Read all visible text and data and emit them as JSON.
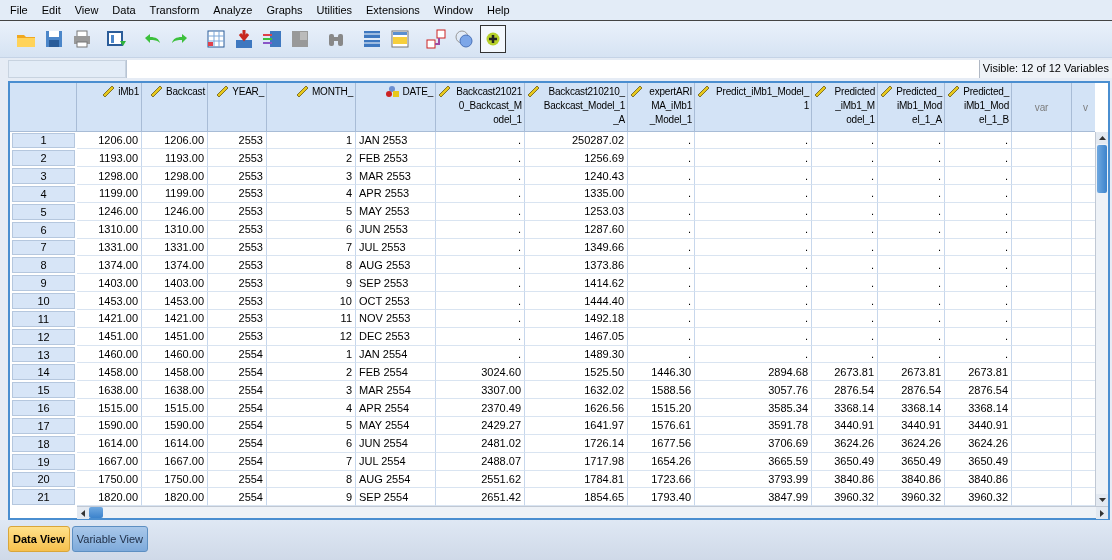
{
  "menu": [
    "File",
    "Edit",
    "View",
    "Data",
    "Transform",
    "Analyze",
    "Graphs",
    "Utilities",
    "Extensions",
    "Window",
    "Help"
  ],
  "visible_label": "Visible: 12 of 12 Variables",
  "columns": [
    {
      "label": "iMb1",
      "kind": "scale"
    },
    {
      "label": "Backcast",
      "kind": "scale"
    },
    {
      "label": "YEAR_",
      "kind": "scale"
    },
    {
      "label": "MONTH_",
      "kind": "scale"
    },
    {
      "label": "DATE_",
      "kind": "nominal"
    },
    {
      "label": "Backcast210210_Backcast_Model_1",
      "kind": "scale"
    },
    {
      "label": "Backcast210210_Backcast_Model_1_A",
      "kind": "scale"
    },
    {
      "label": "expertARIMA_iMb1_Model_1",
      "kind": "scale"
    },
    {
      "label": "Predict_iMb1_Model_1",
      "kind": "scale"
    },
    {
      "label": "Predicted_iMb1_Model_1",
      "kind": "scale"
    },
    {
      "label": "Predicted_iMb1_Model_1_A",
      "kind": "scale"
    },
    {
      "label": "Predicted_iMb1_Model_1_B",
      "kind": "scale"
    },
    {
      "label": "var",
      "kind": "empty"
    },
    {
      "label": "v",
      "kind": "empty"
    }
  ],
  "rows": [
    {
      "number": "1",
      "cells": [
        "1206.00",
        "1206.00",
        "2553",
        "1",
        "JAN 2553",
        ".",
        "250287.02",
        ".",
        ".",
        ".",
        ".",
        "."
      ]
    },
    {
      "number": "2",
      "cells": [
        "1193.00",
        "1193.00",
        "2553",
        "2",
        "FEB 2553",
        ".",
        "1256.69",
        ".",
        ".",
        ".",
        ".",
        "."
      ]
    },
    {
      "number": "3",
      "cells": [
        "1298.00",
        "1298.00",
        "2553",
        "3",
        "MAR 2553",
        ".",
        "1240.43",
        ".",
        ".",
        ".",
        ".",
        "."
      ]
    },
    {
      "number": "4",
      "cells": [
        "1199.00",
        "1199.00",
        "2553",
        "4",
        "APR 2553",
        ".",
        "1335.00",
        ".",
        ".",
        ".",
        ".",
        "."
      ]
    },
    {
      "number": "5",
      "cells": [
        "1246.00",
        "1246.00",
        "2553",
        "5",
        "MAY 2553",
        ".",
        "1253.03",
        ".",
        ".",
        ".",
        ".",
        "."
      ]
    },
    {
      "number": "6",
      "cells": [
        "1310.00",
        "1310.00",
        "2553",
        "6",
        "JUN 2553",
        ".",
        "1287.60",
        ".",
        ".",
        ".",
        ".",
        "."
      ]
    },
    {
      "number": "7",
      "cells": [
        "1331.00",
        "1331.00",
        "2553",
        "7",
        "JUL 2553",
        ".",
        "1349.66",
        ".",
        ".",
        ".",
        ".",
        "."
      ]
    },
    {
      "number": "8",
      "cells": [
        "1374.00",
        "1374.00",
        "2553",
        "8",
        "AUG 2553",
        ".",
        "1373.86",
        ".",
        ".",
        ".",
        ".",
        "."
      ]
    },
    {
      "number": "9",
      "cells": [
        "1403.00",
        "1403.00",
        "2553",
        "9",
        "SEP 2553",
        ".",
        "1414.62",
        ".",
        ".",
        ".",
        ".",
        "."
      ]
    },
    {
      "number": "10",
      "cells": [
        "1453.00",
        "1453.00",
        "2553",
        "10",
        "OCT 2553",
        ".",
        "1444.40",
        ".",
        ".",
        ".",
        ".",
        "."
      ]
    },
    {
      "number": "11",
      "cells": [
        "1421.00",
        "1421.00",
        "2553",
        "11",
        "NOV 2553",
        ".",
        "1492.18",
        ".",
        ".",
        ".",
        ".",
        "."
      ]
    },
    {
      "number": "12",
      "cells": [
        "1451.00",
        "1451.00",
        "2553",
        "12",
        "DEC 2553",
        ".",
        "1467.05",
        ".",
        ".",
        ".",
        ".",
        "."
      ]
    },
    {
      "number": "13",
      "cells": [
        "1460.00",
        "1460.00",
        "2554",
        "1",
        "JAN 2554",
        ".",
        "1489.30",
        ".",
        ".",
        ".",
        ".",
        "."
      ]
    },
    {
      "number": "14",
      "cells": [
        "1458.00",
        "1458.00",
        "2554",
        "2",
        "FEB 2554",
        "3024.60",
        "1525.50",
        "1446.30",
        "2894.68",
        "2673.81",
        "2673.81",
        "2673.81"
      ]
    },
    {
      "number": "15",
      "cells": [
        "1638.00",
        "1638.00",
        "2554",
        "3",
        "MAR 2554",
        "3307.00",
        "1632.02",
        "1588.56",
        "3057.76",
        "2876.54",
        "2876.54",
        "2876.54"
      ]
    },
    {
      "number": "16",
      "cells": [
        "1515.00",
        "1515.00",
        "2554",
        "4",
        "APR 2554",
        "2370.49",
        "1626.56",
        "1515.20",
        "3585.34",
        "3368.14",
        "3368.14",
        "3368.14"
      ]
    },
    {
      "number": "17",
      "cells": [
        "1590.00",
        "1590.00",
        "2554",
        "5",
        "MAY 2554",
        "2429.27",
        "1641.97",
        "1576.61",
        "3591.78",
        "3440.91",
        "3440.91",
        "3440.91"
      ]
    },
    {
      "number": "18",
      "cells": [
        "1614.00",
        "1614.00",
        "2554",
        "6",
        "JUN 2554",
        "2481.02",
        "1726.14",
        "1677.56",
        "3706.69",
        "3624.26",
        "3624.26",
        "3624.26"
      ]
    },
    {
      "number": "19",
      "cells": [
        "1667.00",
        "1667.00",
        "2554",
        "7",
        "JUL 2554",
        "2488.07",
        "1717.98",
        "1654.26",
        "3665.59",
        "3650.49",
        "3650.49",
        "3650.49"
      ]
    },
    {
      "number": "20",
      "cells": [
        "1750.00",
        "1750.00",
        "2554",
        "8",
        "AUG 2554",
        "2551.62",
        "1784.81",
        "1723.66",
        "3793.99",
        "3840.86",
        "3840.86",
        "3840.86"
      ]
    },
    {
      "number": "21",
      "cells": [
        "1820.00",
        "1820.00",
        "2554",
        "9",
        "SEP 2554",
        "2651.42",
        "1854.65",
        "1793.40",
        "3847.99",
        "3960.32",
        "3960.32",
        "3960.32"
      ]
    }
  ],
  "tabs": [
    {
      "label": "Data View",
      "selected": true
    },
    {
      "label": "Variable View",
      "selected": false
    }
  ]
}
